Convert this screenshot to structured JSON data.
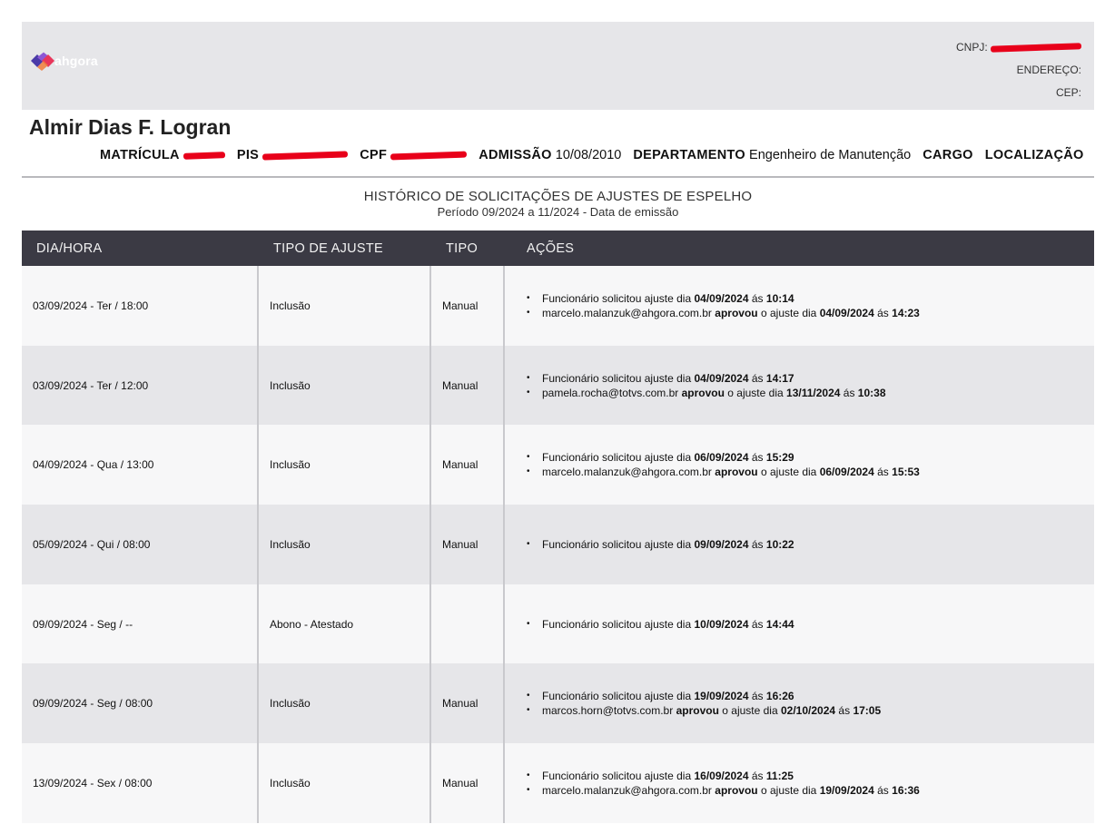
{
  "header": {
    "logo_text": "ahgora",
    "cnpj_label": "CNPJ:",
    "endereco_label": "ENDEREÇO:",
    "cep_label": "CEP:"
  },
  "employee": {
    "name": "Almir Dias F. Logran",
    "matricula_label": "MATRÍCULA",
    "pis_label": "PIS",
    "cpf_label": "CPF",
    "admissao_label": "ADMISSÃO",
    "admissao_value": "10/08/2010",
    "departamento_label": "DEPARTAMENTO",
    "departamento_value": "Engenheiro de Manutenção",
    "cargo_label": "CARGO",
    "localizacao_label": "LOCALIZAÇÃO"
  },
  "report": {
    "title": "HISTÓRICO DE SOLICITAÇÕES DE AJUSTES DE ESPELHO",
    "subtitle": "Período 09/2024 a 11/2024 - Data de emissão"
  },
  "table": {
    "headers": [
      "DIA/HORA",
      "TIPO DE AJUSTE",
      "TIPO",
      "AÇÕES"
    ],
    "rows": [
      {
        "dia_hora": "03/09/2024 - Ter / 18:00",
        "tipo_ajuste": "Inclusão",
        "tipo": "Manual",
        "acoes": [
          {
            "actor": "Funcionário",
            "verb": "solicitou",
            "mid": "ajuste dia",
            "date": "04/09/2024",
            "as": "ás",
            "time": "10:14"
          },
          {
            "actor": "marcelo.malanzuk@ahgora.com.br",
            "verb": "aprovou",
            "mid": "o ajuste dia",
            "date": "04/09/2024",
            "as": "ás",
            "time": "14:23"
          }
        ]
      },
      {
        "dia_hora": "03/09/2024 - Ter / 12:00",
        "tipo_ajuste": "Inclusão",
        "tipo": "Manual",
        "acoes": [
          {
            "actor": "Funcionário",
            "verb": "solicitou",
            "mid": "ajuste dia",
            "date": "04/09/2024",
            "as": "ás",
            "time": "14:17"
          },
          {
            "actor": "pamela.rocha@totvs.com.br",
            "verb": "aprovou",
            "mid": "o ajuste dia",
            "date": "13/11/2024",
            "as": "ás",
            "time": "10:38"
          }
        ]
      },
      {
        "dia_hora": "04/09/2024 - Qua / 13:00",
        "tipo_ajuste": "Inclusão",
        "tipo": "Manual",
        "acoes": [
          {
            "actor": "Funcionário",
            "verb": "solicitou",
            "mid": "ajuste dia",
            "date": "06/09/2024",
            "as": "ás",
            "time": "15:29"
          },
          {
            "actor": "marcelo.malanzuk@ahgora.com.br",
            "verb": "aprovou",
            "mid": "o ajuste dia",
            "date": "06/09/2024",
            "as": "ás",
            "time": "15:53"
          }
        ]
      },
      {
        "dia_hora": "05/09/2024 - Qui / 08:00",
        "tipo_ajuste": "Inclusão",
        "tipo": "Manual",
        "acoes": [
          {
            "actor": "Funcionário",
            "verb": "solicitou",
            "mid": "ajuste dia",
            "date": "09/09/2024",
            "as": "ás",
            "time": "10:22"
          }
        ]
      },
      {
        "dia_hora": "09/09/2024 - Seg / --",
        "tipo_ajuste": "Abono - Atestado",
        "tipo": "",
        "acoes": [
          {
            "actor": "Funcionário",
            "verb": "solicitou",
            "mid": "ajuste dia",
            "date": "10/09/2024",
            "as": "ás",
            "time": "14:44"
          }
        ]
      },
      {
        "dia_hora": "09/09/2024 - Seg / 08:00",
        "tipo_ajuste": "Inclusão",
        "tipo": "Manual",
        "acoes": [
          {
            "actor": "Funcionário",
            "verb": "solicitou",
            "mid": "ajuste dia",
            "date": "19/09/2024",
            "as": "ás",
            "time": "16:26"
          },
          {
            "actor": "marcos.horn@totvs.com.br",
            "verb": "aprovou",
            "mid": "o ajuste dia",
            "date": "02/10/2024",
            "as": "ás",
            "time": "17:05"
          }
        ]
      },
      {
        "dia_hora": "13/09/2024 - Sex / 08:00",
        "tipo_ajuste": "Inclusão",
        "tipo": "Manual",
        "acoes": [
          {
            "actor": "Funcionário",
            "verb": "solicitou",
            "mid": "ajuste dia",
            "date": "16/09/2024",
            "as": "ás",
            "time": "11:25"
          },
          {
            "actor": "marcelo.malanzuk@ahgora.com.br",
            "verb": "aprovou",
            "mid": "o ajuste dia",
            "date": "19/09/2024",
            "as": "ás",
            "time": "16:36"
          }
        ]
      }
    ]
  },
  "colors": {
    "header_bg": "#e6e6e9",
    "table_header_bg": "#3b3a44",
    "row_light": "#f7f7f8",
    "row_dark": "#e6e6e9",
    "redaction": "#e8001a"
  }
}
